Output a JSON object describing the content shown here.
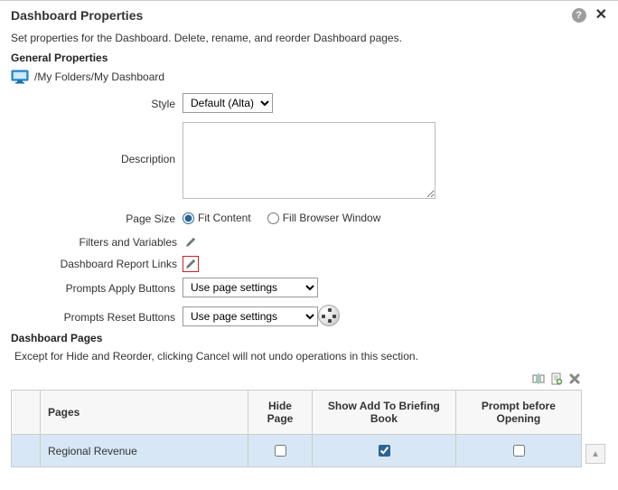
{
  "header": {
    "title": "Dashboard Properties"
  },
  "subtitle": "Set properties for the Dashboard. Delete, rename, and reorder Dashboard pages.",
  "general": {
    "title": "General Properties",
    "path": "/My Folders/My Dashboard",
    "style_label": "Style",
    "style_value": "Default (Alta)",
    "description_label": "Description",
    "description_value": "",
    "page_size_label": "Page Size",
    "page_size_fit": "Fit Content",
    "page_size_fill": "Fill Browser Window",
    "filters_label": "Filters and Variables",
    "report_links_label": "Dashboard Report Links",
    "prompts_apply_label": "Prompts Apply Buttons",
    "prompts_apply_value": "Use page settings",
    "prompts_reset_label": "Prompts Reset Buttons",
    "prompts_reset_value": "Use page settings"
  },
  "pages_section": {
    "title": "Dashboard Pages",
    "note": "Except for Hide and Reorder, clicking Cancel will not undo operations in this section.",
    "columns": {
      "pages": "Pages",
      "hide": "Hide Page",
      "briefing": "Show Add To Briefing Book",
      "prompt": "Prompt before Opening"
    },
    "rows": [
      {
        "name": "Regional Revenue",
        "hide": false,
        "briefing": true,
        "prompt": false
      }
    ]
  }
}
